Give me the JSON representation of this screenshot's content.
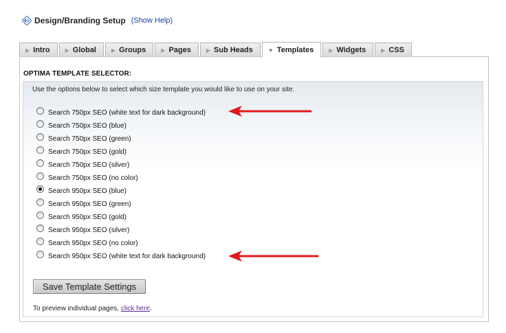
{
  "header": {
    "title": "Design/Branding Setup",
    "help_link": "(Show Help)"
  },
  "tabs": [
    {
      "label": "Intro",
      "active": false
    },
    {
      "label": "Global",
      "active": false
    },
    {
      "label": "Groups",
      "active": false
    },
    {
      "label": "Pages",
      "active": false
    },
    {
      "label": "Sub Heads",
      "active": false
    },
    {
      "label": "Templates",
      "active": true
    },
    {
      "label": "Widgets",
      "active": false
    },
    {
      "label": "CSS",
      "active": false
    }
  ],
  "section": {
    "title": "OPTIMA TEMPLATE SELECTOR:",
    "intro": "Use the options below to select which size template you would like to use on your site."
  },
  "options": [
    {
      "label": "Search 750px SEO (white text for dark background)",
      "checked": false
    },
    {
      "label": "Search 750px SEO (blue)",
      "checked": false
    },
    {
      "label": "Search 750px SEO (green)",
      "checked": false
    },
    {
      "label": "Search 750px SEO (gold)",
      "checked": false
    },
    {
      "label": "Search 750px SEO (silver)",
      "checked": false
    },
    {
      "label": "Search 750px SEO (no color)",
      "checked": false
    },
    {
      "label": "Search 950px SEO (blue)",
      "checked": true
    },
    {
      "label": "Search 950px SEO (green)",
      "checked": false
    },
    {
      "label": "Search 950px SEO (gold)",
      "checked": false
    },
    {
      "label": "Search 950px SEO (silver)",
      "checked": false
    },
    {
      "label": "Search 950px SEO (no color)",
      "checked": false
    },
    {
      "label": "Search 950px SEO (white text for dark background)",
      "checked": false
    }
  ],
  "save_button": "Save Template Settings",
  "preview": {
    "prefix": "To preview individual pages, ",
    "link": "click here",
    "suffix": "."
  },
  "colors": {
    "annotation_arrow": "#e0191c",
    "link_visited": "#5f2d91",
    "help_link": "#1f3f9f"
  },
  "icons": {
    "header": "design-diamond-icon",
    "tab": "triangle-right-icon",
    "active_tab": "triangle-down-icon",
    "annotation": "red-arrow-icon"
  }
}
